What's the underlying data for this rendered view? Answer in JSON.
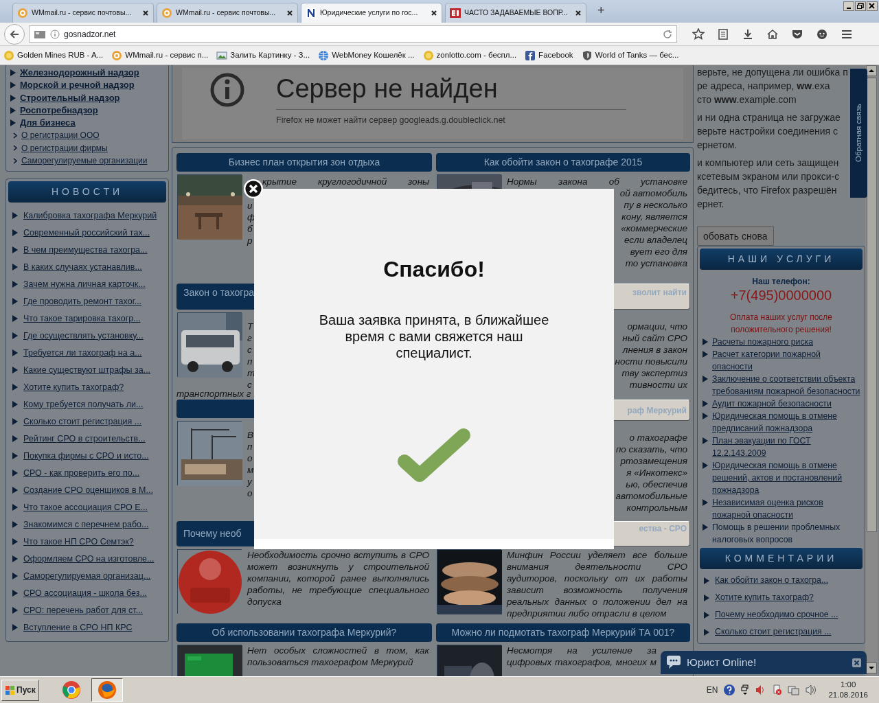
{
  "browser": {
    "tabs": [
      {
        "title": "WMmail.ru - сервис почтовы...",
        "selected": false
      },
      {
        "title": "WMmail.ru - сервис почтовы...",
        "selected": false
      },
      {
        "title": "Юридические услуги по гос...",
        "selected": true
      },
      {
        "title": "ЧАСТО ЗАДАВАЕМЫЕ ВОПР...",
        "selected": false
      }
    ],
    "new_tab": "+",
    "url": "gosnadzor.net",
    "bookmarks": [
      {
        "label": "Golden Mines RUB - A..."
      },
      {
        "label": "WMmail.ru - сервис п..."
      },
      {
        "label": "Залить Картинку - З..."
      },
      {
        "label": "WebMoney Кошелёк ..."
      },
      {
        "label": "zonlotto.com - беспл..."
      },
      {
        "label": "Facebook"
      },
      {
        "label": "World of Tanks — бес..."
      }
    ]
  },
  "left_sidebar": {
    "links": [
      {
        "label": "Железнодорожный надзор",
        "kind": "section"
      },
      {
        "label": "Морской и речной надзор",
        "kind": "section"
      },
      {
        "label": "Строительный надзор",
        "kind": "section"
      },
      {
        "label": "Роспотребнадзор",
        "kind": "section"
      },
      {
        "label": "Для бизнеса",
        "kind": "section"
      },
      {
        "label": "О регистрации ООО",
        "kind": "sub"
      },
      {
        "label": "О регистрации фирмы",
        "kind": "sub"
      },
      {
        "label": "Саморегулируемые организации",
        "kind": "sub"
      }
    ],
    "news_title": "НОВОСТИ",
    "news": [
      "Калибровка тахографа Меркурий",
      "Современный российский тах...",
      "В чем преимущества тахогра...",
      "В каких случаях устанавлив...",
      "Зачем нужна личная карточк...",
      "Где проводить ремонт тахог...",
      "Что такое тарировка тахогр...",
      "Где осуществлять установку...",
      "Требуется ли тахограф на а...",
      "Какие существуют штрафы за...",
      "Хотите купить тахограф?",
      "Кому требуется получать ли...",
      "Сколько стоит регистрация ...",
      "Рейтинг СРО в строительств...",
      "Покупка фирмы с СРО и исто...",
      "СРО - как проверить его по...",
      "Создание СРО оценщиков в М...",
      "Что такое ассоциация СРО Е...",
      "Знакомимся с перечнем рабо...",
      "Что такое НП СРО Семтэк?",
      "Оформляем СРО на изготовле...",
      "Саморегулируемая организац...",
      "СРО ассоциация - школа без...",
      "СРО: перечень работ для ст...",
      "Вступление в СРО НП КРС"
    ]
  },
  "error_frame": {
    "title": "Сервер не найден",
    "message": "Firefox не может найти сервер googleads.g.doubleclick.net",
    "side_paragraphs": [
      [
        "верьте, не допущена ли ошибка п",
        "ре адреса, например, **ww**.exa",
        "сто **www**.example.com"
      ],
      [
        "и ни одна страница не загружае",
        "верьте настройки соединения с",
        "ернетом."
      ],
      [
        "и компьютер или сеть защищен",
        "ксетевым экраном или прокси-с",
        "бедитесь, что Firefox разрешён",
        "ернет."
      ]
    ],
    "retry_button": "обовать снова"
  },
  "articles": [
    {
      "header": {
        "title": "Бизнес план открытия зон отдыха",
        "kind": "full"
      },
      "kind": "cut_right",
      "lead": "крытие круглогодичной зоны",
      "fragments": [
        "и",
        "ф",
        "б",
        "р"
      ]
    },
    {
      "header": {
        "title": "Как обойти закон о тахографе 2015",
        "kind": "full"
      },
      "kind": "cut_left",
      "lead": "Нормы закона об установке",
      "fragments": [
        "ой автомобиль",
        "пу в несколько",
        "кону, является",
        "«коммерческие",
        "если владелец",
        "вует его для",
        "то установка"
      ]
    },
    {
      "header": {
        "title": "Закон о тахогра",
        "kind": "cut_end"
      },
      "kind": "cut_right",
      "fragments": [
        "Т",
        "г",
        "с",
        "п",
        "т",
        "с"
      ],
      "tail": "транспортных г"
    },
    {
      "header": {
        "title": "зволит найти",
        "kind": "cut_start"
      },
      "kind": "cut_left",
      "fragments": [
        "ормации, что",
        "ный сайт СРО",
        "лнения в закон",
        "ности повысили",
        "тву экспертиз",
        "тивности их"
      ]
    },
    {
      "header": {
        "kind": "empty"
      },
      "kind": "cut_right",
      "fragments": [
        "В",
        "п",
        "о",
        "м",
        "у",
        "о"
      ]
    },
    {
      "header": {
        "title": "раф Меркурий",
        "kind": "cut_start"
      },
      "kind": "cut_left",
      "fragments": [
        "о тахографе",
        "по сказать, что",
        "ртозамещения",
        "я «Инкотекс»",
        "ью, обеспечив",
        "автомобильные",
        "контрольным"
      ]
    },
    {
      "header": {
        "title": "Почему необ",
        "kind": "cut_end"
      },
      "kind": "full",
      "text": "Необходимость срочно вступить в СРО может возникнуть у строительной компании, которой ранее выполнялись работы, не требующие специального допуска"
    },
    {
      "header": {
        "title": "ества - СРО",
        "kind": "cut_start"
      },
      "kind": "full",
      "text": "Минфин России уделяет все больше внимания деятельности СРО аудиторов, поскольку от их работы зависит возможность получения реальных данных о положении дел на предприятии либо отрасли в целом"
    },
    {
      "header": {
        "title": "Об использовании тахографа Меркурий?",
        "kind": "full"
      },
      "kind": "full",
      "text": "Нет особых сложностей в том, как пользоваться тахографом Меркурий"
    },
    {
      "header": {
        "title": "Можно ли подмотать тахограф Меркурий ТА 001?",
        "kind": "full"
      },
      "kind": "lines",
      "lines": [
        "Несмотря на усиление за",
        "цифровых тахографов, многих м"
      ]
    }
  ],
  "feedback_tab": "Обратная связь",
  "services": {
    "title": "НАШИ УСЛУГИ",
    "phone_label": "Наш телефон:",
    "phone": "+7(495)0000000",
    "note": "Оплата наших услуг после положительного решения!",
    "items": [
      {
        "label": "Расчеты пожарного риска",
        "link": true
      },
      {
        "label": "Расчет категории пожарной опасности",
        "link": true
      },
      {
        "label": "Заключение о соответствии объекта требованиям пожарной безопасности",
        "link": true
      },
      {
        "label": "Аудит пожарной безопасности",
        "link": true
      },
      {
        "label": "Юридическая помощь в отмене предписаний пожнадзора",
        "link": true
      },
      {
        "label": "План эвакуации по ГОСТ 12.2.143.2009",
        "link": true
      },
      {
        "label": "Юридическая помощь в отмене решений, актов и постановлений пожнадзора",
        "link": true
      },
      {
        "label": "Независимая оценка рисков пожарной опасности",
        "link": true
      },
      {
        "label": "Помощь в решении проблемных налоговых вопросов",
        "link": false
      }
    ]
  },
  "comments": {
    "title": "КОММЕНТАРИИ",
    "items": [
      "Как обойти закон о тахогра...",
      "Хотите купить тахограф?",
      "Почему необходимо срочное ...",
      "Сколько стоит регистрация ..."
    ]
  },
  "chat": {
    "label": "Юрист Online!"
  },
  "modal": {
    "title": "Спасибо!",
    "message": "Ваша заявка принята, в ближайшее время с вами свяжется наш специалист."
  },
  "taskbar": {
    "start": "Пуск",
    "language": "EN",
    "time": "1:00",
    "date": "21.08.2016"
  }
}
